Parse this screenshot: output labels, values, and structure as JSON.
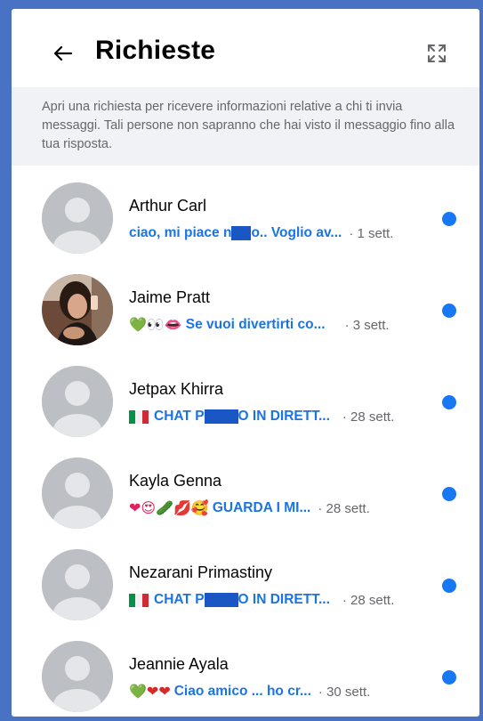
{
  "header": {
    "title": "Richieste"
  },
  "info_text": "Apri una richiesta per ricevere informazioni relative a chi ti invia messaggi. Tali persone non sapranno che hai visto il messaggio fino alla tua risposta.",
  "requests": [
    {
      "name": "Arthur Carl",
      "emoji": "",
      "preview_a": "ciao, mi piace n",
      "preview_b": "o.. Voglio av...",
      "time": "· 1 sett.",
      "avatar": "placeholder"
    },
    {
      "name": "Jaime Pratt",
      "emoji": "💚👀👄",
      "preview_a": "Se vuoi divertirti co...",
      "preview_b": "",
      "time": "· 3 sett.",
      "avatar": "photo"
    },
    {
      "name": "Jetpax Khirra",
      "emoji": "flag",
      "preview_a": "CHAT P",
      "preview_b": "O IN DIRETT...",
      "time": "· 28 sett.",
      "avatar": "placeholder"
    },
    {
      "name": "Kayla Genna",
      "emoji": "❤😍🥒💋🥰",
      "preview_a": "GUARDA I MI...",
      "preview_b": "",
      "time": "· 28 sett.",
      "avatar": "placeholder"
    },
    {
      "name": "Nezarani Primastiny",
      "emoji": "flag",
      "preview_a": "CHAT P",
      "preview_b": "O IN DIRETT...",
      "time": "· 28 sett.",
      "avatar": "placeholder"
    },
    {
      "name": "Jeannie Ayala",
      "emoji": "💚❤❤",
      "preview_a": "Ciao amico ... ho cr...",
      "preview_b": "",
      "time": "· 30 sett.",
      "avatar": "placeholder"
    }
  ],
  "colors": {
    "accent": "#1877f2",
    "frame": "#4a72c4",
    "unread_dot": "#1877f2"
  }
}
